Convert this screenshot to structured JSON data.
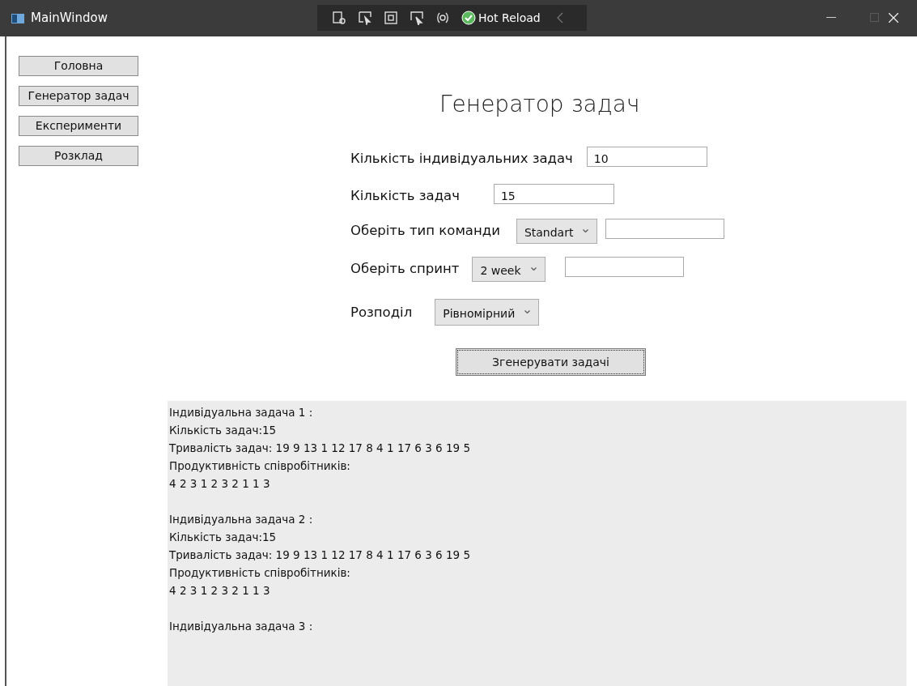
{
  "window": {
    "title": "MainWindow",
    "maximize_disabled": true
  },
  "toolbar": {
    "hot_reload": "Hot Reload"
  },
  "nav": [
    {
      "label": "Головна",
      "selected": false
    },
    {
      "label": "Генератор задач",
      "selected": false
    },
    {
      "label": "Експерименти",
      "selected": false
    },
    {
      "label": "Розклад",
      "selected": false
    }
  ],
  "heading": "Генератор задач",
  "form": [
    {
      "kind": "text",
      "label": "Кількість індивідуальних задач",
      "value": "10"
    },
    {
      "kind": "text",
      "label": "Кількість задач",
      "value": "15"
    },
    {
      "kind": "combo_text",
      "label": "Оберіть тип команди",
      "value": "Standart"
    },
    {
      "kind": "combo_text",
      "label": "Оберіть спринт",
      "value": "2 week"
    },
    {
      "kind": "combo",
      "label": "Розподіл",
      "value": "Рівномірний"
    }
  ],
  "generate_button": "Згенерувати задачі",
  "output": [
    [
      "Індивідуальна задача 1 :",
      "Кількість задач:15",
      "Тривалість задач: 19 9 13 1 12 17 8 4 1 17 6 3 6 19 5",
      "Продуктивність співробітників:",
      "4 2 3 1 2 3 2 1 1 3"
    ],
    [
      "Індивідуальна задача 2 :",
      "Кількість задач:15",
      "Тривалість задач: 19 9 13 1 12 17 8 4 1 17 6 3 6 19 5",
      "Продуктивність співробітників:",
      "4 2 3 1 2 3 2 1 1 3"
    ],
    [
      "Індивідуальна задача 3 :"
    ]
  ]
}
